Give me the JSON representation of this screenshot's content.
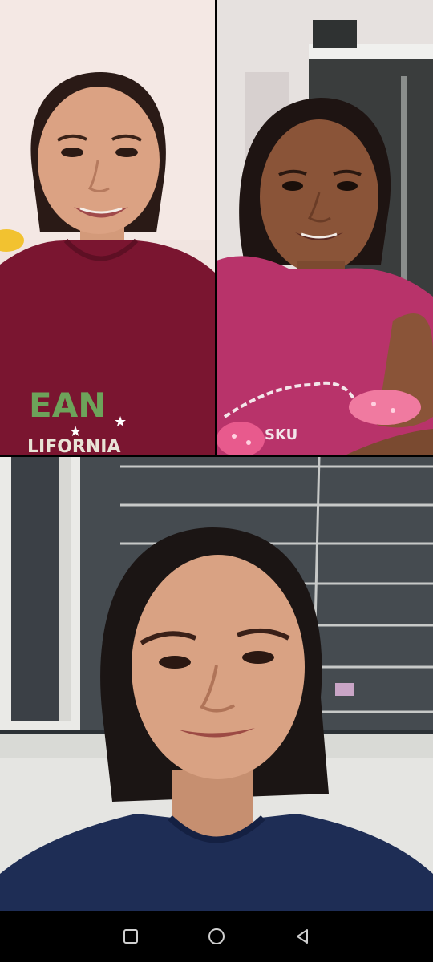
{
  "call": {
    "participants": [
      {
        "tile": "top-left",
        "shirt_color": "#7a1530",
        "shirt_text_line1": "EAN",
        "shirt_text_line2": "LIFORNIA"
      },
      {
        "tile": "top-right",
        "shirt_color": "#b8336a"
      },
      {
        "tile": "bottom",
        "shirt_color": "#1e2d55"
      }
    ]
  },
  "navbar": {
    "buttons": [
      {
        "icon": "square-recents-icon"
      },
      {
        "icon": "circle-home-icon"
      },
      {
        "icon": "triangle-back-icon"
      }
    ]
  },
  "colors": {
    "navbar_bg": "#000000",
    "nav_icon": "#cfcfcf"
  }
}
